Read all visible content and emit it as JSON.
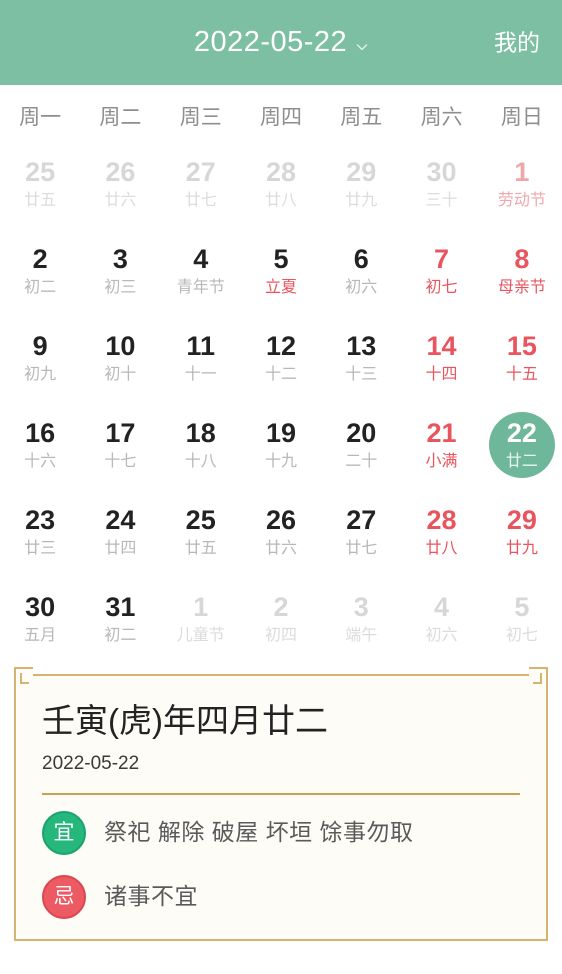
{
  "header": {
    "title": "2022-05-22",
    "dropdown_icon": "chevron-down-icon",
    "action_label": "我的"
  },
  "weekdays": [
    "周一",
    "周二",
    "周三",
    "周四",
    "周五",
    "周六",
    "周日"
  ],
  "colors": {
    "header_bg": "#7dbfa2",
    "selected_bg": "#6fb79a",
    "holiday_red": "#e8555f",
    "card_border_gold": "#d6b370",
    "card_bg": "#fdfcf7",
    "good_badge": "#26b77d",
    "bad_badge": "#ec5a63"
  },
  "days": [
    {
      "num": "25",
      "sub": "廿五",
      "state": "muted"
    },
    {
      "num": "26",
      "sub": "廿六",
      "state": "muted"
    },
    {
      "num": "27",
      "sub": "廿七",
      "state": "muted"
    },
    {
      "num": "28",
      "sub": "廿八",
      "state": "muted"
    },
    {
      "num": "29",
      "sub": "廿九",
      "state": "muted"
    },
    {
      "num": "30",
      "sub": "三十",
      "state": "muted"
    },
    {
      "num": "1",
      "sub": "劳动节",
      "state": "muted-holiday"
    },
    {
      "num": "2",
      "sub": "初二",
      "state": "normal"
    },
    {
      "num": "3",
      "sub": "初三",
      "state": "normal"
    },
    {
      "num": "4",
      "sub": "青年节",
      "state": "normal"
    },
    {
      "num": "5",
      "sub": "立夏",
      "state": "subred"
    },
    {
      "num": "6",
      "sub": "初六",
      "state": "normal"
    },
    {
      "num": "7",
      "sub": "初七",
      "state": "holiday"
    },
    {
      "num": "8",
      "sub": "母亲节",
      "state": "holiday"
    },
    {
      "num": "9",
      "sub": "初九",
      "state": "normal"
    },
    {
      "num": "10",
      "sub": "初十",
      "state": "normal"
    },
    {
      "num": "11",
      "sub": "十一",
      "state": "normal"
    },
    {
      "num": "12",
      "sub": "十二",
      "state": "normal"
    },
    {
      "num": "13",
      "sub": "十三",
      "state": "normal"
    },
    {
      "num": "14",
      "sub": "十四",
      "state": "holiday"
    },
    {
      "num": "15",
      "sub": "十五",
      "state": "holiday"
    },
    {
      "num": "16",
      "sub": "十六",
      "state": "normal"
    },
    {
      "num": "17",
      "sub": "十七",
      "state": "normal"
    },
    {
      "num": "18",
      "sub": "十八",
      "state": "normal"
    },
    {
      "num": "19",
      "sub": "十九",
      "state": "normal"
    },
    {
      "num": "20",
      "sub": "二十",
      "state": "normal"
    },
    {
      "num": "21",
      "sub": "小满",
      "state": "holiday"
    },
    {
      "num": "22",
      "sub": "廿二",
      "state": "selected"
    },
    {
      "num": "23",
      "sub": "廿三",
      "state": "normal"
    },
    {
      "num": "24",
      "sub": "廿四",
      "state": "normal"
    },
    {
      "num": "25",
      "sub": "廿五",
      "state": "normal"
    },
    {
      "num": "26",
      "sub": "廿六",
      "state": "normal"
    },
    {
      "num": "27",
      "sub": "廿七",
      "state": "normal"
    },
    {
      "num": "28",
      "sub": "廿八",
      "state": "holiday"
    },
    {
      "num": "29",
      "sub": "廿九",
      "state": "holiday"
    },
    {
      "num": "30",
      "sub": "五月",
      "state": "normal"
    },
    {
      "num": "31",
      "sub": "初二",
      "state": "normal"
    },
    {
      "num": "1",
      "sub": "儿童节",
      "state": "muted"
    },
    {
      "num": "2",
      "sub": "初四",
      "state": "muted"
    },
    {
      "num": "3",
      "sub": "端午",
      "state": "muted"
    },
    {
      "num": "4",
      "sub": "初六",
      "state": "muted"
    },
    {
      "num": "5",
      "sub": "初七",
      "state": "muted"
    }
  ],
  "info_card": {
    "lunar_title": "壬寅(虎)年四月廿二",
    "solar_date": "2022-05-22",
    "good": {
      "badge": "宜",
      "text": "祭祀 解除 破屋 坏垣 馀事勿取"
    },
    "bad": {
      "badge": "忌",
      "text": "诸事不宜"
    }
  }
}
